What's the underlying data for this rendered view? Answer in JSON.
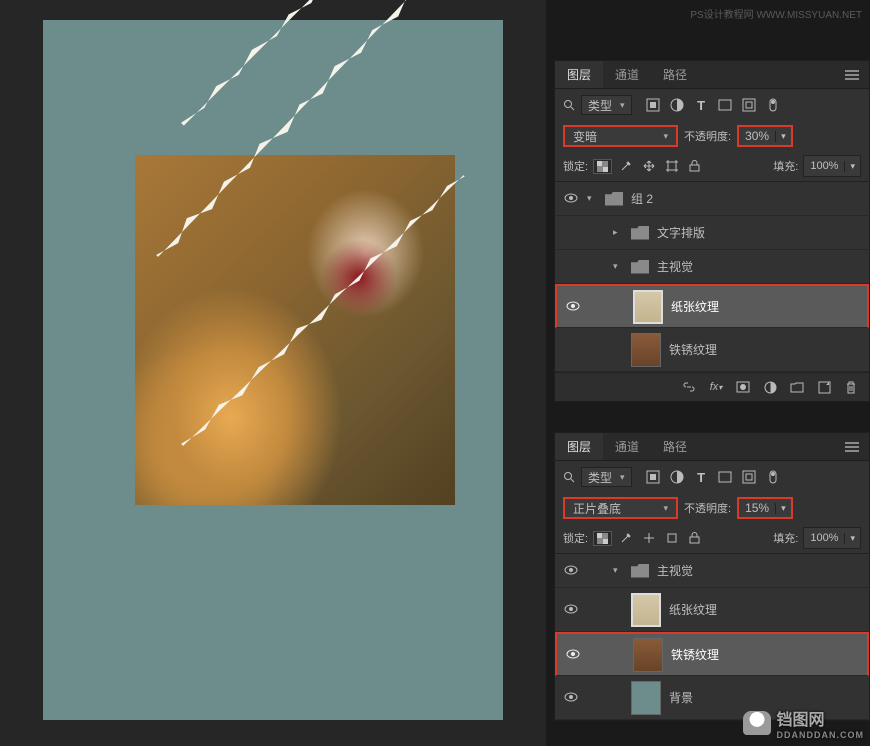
{
  "watermarks": {
    "top": "PS设计教程网  WWW.MISSYUAN.NET",
    "bottom": "铛图网",
    "bottom_sub": "DDANDDAN.COM"
  },
  "panel1": {
    "tabs": {
      "layers": "图层",
      "channels": "通道",
      "paths": "路径"
    },
    "type_label": "类型",
    "blend_mode": "变暗",
    "opacity_label": "不透明度:",
    "opacity_value": "30%",
    "lock_label": "锁定:",
    "fill_label": "填充:",
    "fill_value": "100%",
    "layers": {
      "group2": "组 2",
      "text_layout": "文字排版",
      "main_visual": "主视觉",
      "paper_texture": "纸张纹理",
      "rust_texture": "铁锈纹理"
    }
  },
  "panel2": {
    "tabs": {
      "layers": "图层",
      "channels": "通道",
      "paths": "路径"
    },
    "type_label": "类型",
    "blend_mode": "正片叠底",
    "opacity_label": "不透明度:",
    "opacity_value": "15%",
    "lock_label": "锁定:",
    "fill_label": "填充:",
    "fill_value": "100%",
    "layers": {
      "main_visual": "主视觉",
      "paper_texture": "纸张纹理",
      "rust_texture": "铁锈纹理",
      "background": "背景"
    }
  }
}
